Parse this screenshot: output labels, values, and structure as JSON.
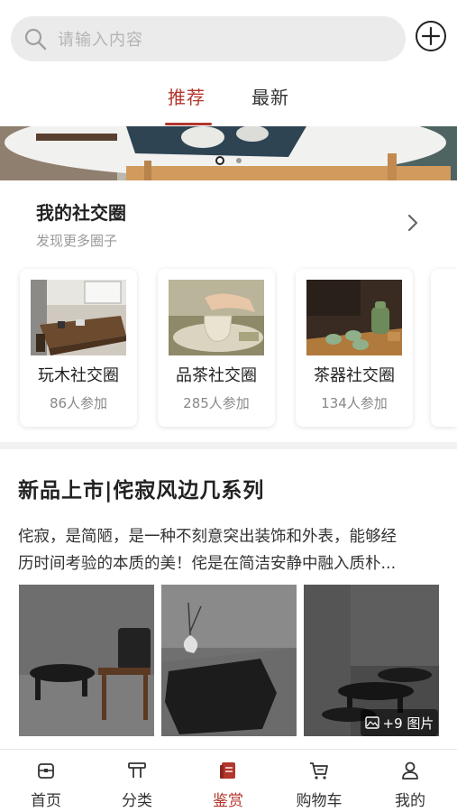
{
  "search": {
    "placeholder": "请输入内容",
    "icon": "search-icon"
  },
  "header": {
    "add_icon": "plus-circle-icon"
  },
  "tabs": [
    {
      "label": "推荐",
      "active": true
    },
    {
      "label": "最新",
      "active": false
    }
  ],
  "banner": {
    "slides": 2,
    "current_slide": 1
  },
  "social": {
    "title": "我的社交圈",
    "subtitle": "发现更多圈子",
    "circles": [
      {
        "name": "玩木社交圈",
        "members": "86人参加"
      },
      {
        "name": "品茶社交圈",
        "members": "285人参加"
      },
      {
        "name": "茶器社交圈",
        "members": "134人参加"
      }
    ]
  },
  "article": {
    "title": "新品上市|侘寂风边几系列",
    "lines": [
      "侘寂，是简陋，是一种不刻意突出装饰和外表，能够经",
      "历时间考验的本质的美！侘是在简洁安静中融入质朴..."
    ],
    "more_photos": "+9 图片"
  },
  "nav": [
    {
      "label": "首页",
      "icon": "home-icon",
      "active": false
    },
    {
      "label": "分类",
      "icon": "category-icon",
      "active": false
    },
    {
      "label": "鉴赏",
      "icon": "appreciate-icon",
      "active": true
    },
    {
      "label": "购物车",
      "icon": "cart-icon",
      "active": false
    },
    {
      "label": "我的",
      "icon": "user-icon",
      "active": false
    }
  ],
  "colors": {
    "accent": "#b2362c",
    "text": "#222222",
    "muted": "#999999"
  }
}
